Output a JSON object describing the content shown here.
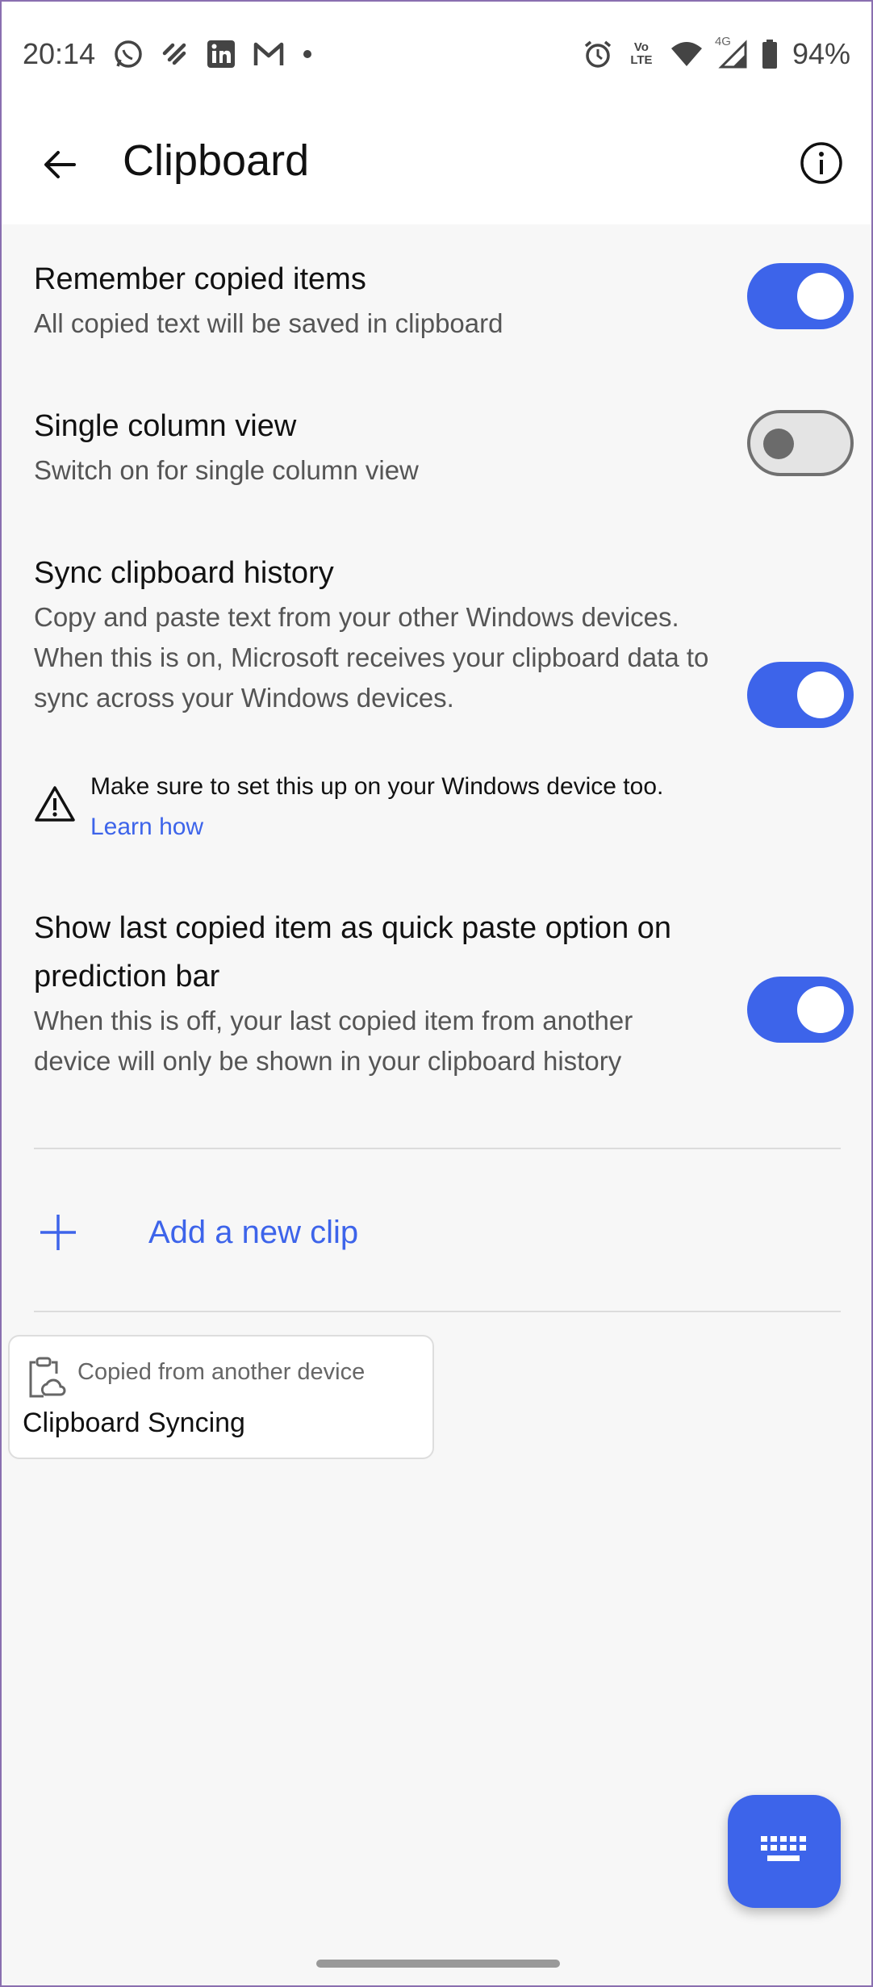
{
  "status_bar": {
    "time": "20:14",
    "left_icons": [
      "whatsapp-icon",
      "app-icon",
      "linkedin-icon",
      "gmail-icon",
      "dot-icon"
    ],
    "right_icons": [
      "alarm-icon",
      "volte-icon",
      "wifi-icon",
      "signal-icon",
      "battery-icon"
    ],
    "volte_label": "Vo LTE",
    "network_label": "4G",
    "battery": "94%"
  },
  "app_bar": {
    "title": "Clipboard"
  },
  "settings": [
    {
      "title": "Remember copied items",
      "description": "All copied text will be saved in clipboard",
      "enabled": true
    },
    {
      "title": "Single column view",
      "description": "Switch on for single column view",
      "enabled": false
    },
    {
      "title": "Sync clipboard history",
      "description": "Copy and paste text from your other Windows devices. When this is on, Microsoft receives your clipboard data to sync across your Windows devices.",
      "enabled": true
    },
    {
      "title": "Show last copied item as quick paste option on prediction bar",
      "description": "When this is off, your last copied item from another device will only be shown in your clipboard history",
      "enabled": true
    }
  ],
  "warning": {
    "text": "Make sure to set this up on your Windows device too.",
    "link": "Learn how"
  },
  "add_clip": {
    "label": "Add a new clip"
  },
  "clip": {
    "source": "Copied from another device",
    "text": "Clipboard Syncing"
  },
  "colors": {
    "accent": "#3d64ea",
    "toggle_off": "#e4e4e4"
  }
}
